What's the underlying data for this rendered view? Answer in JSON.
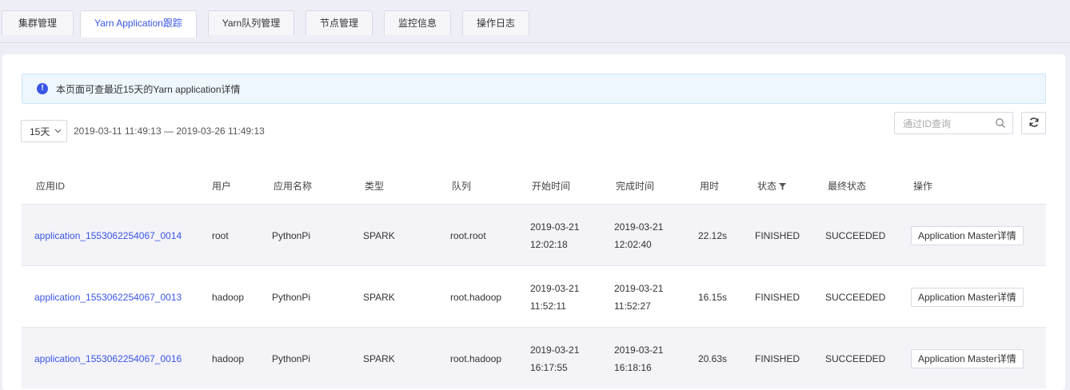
{
  "tabs": [
    {
      "label": "集群管理",
      "active": false
    },
    {
      "label": "Yarn Application跟踪",
      "active": true
    },
    {
      "label": "Yarn队列管理",
      "active": false
    },
    {
      "label": "节点管理",
      "active": false
    },
    {
      "label": "监控信息",
      "active": false
    },
    {
      "label": "操作日志",
      "active": false
    }
  ],
  "notice": {
    "icon": "info-icon",
    "text": "本页面可查最近15天的Yarn application详情"
  },
  "toolbar": {
    "range_value": "15天",
    "range_text": "2019-03-11 11:49:13 — 2019-03-26 11:49:13",
    "search_placeholder": "通过ID查询",
    "refresh_icon": "refresh-icon"
  },
  "table": {
    "headers": {
      "app_id": "应用ID",
      "user": "用户",
      "name": "应用名称",
      "type": "类型",
      "queue": "队列",
      "start": "开始时间",
      "finish": "完成时间",
      "elapsed": "用时",
      "state": "状态",
      "final_state": "最终状态",
      "action": "操作"
    },
    "rows": [
      {
        "app_id": "application_1553062254067_0014",
        "user": "root",
        "name": "PythonPi",
        "type": "SPARK",
        "queue": "root.root",
        "start_date": "2019-03-21",
        "start_time": "12:02:18",
        "finish_date": "2019-03-21",
        "finish_time": "12:02:40",
        "elapsed": "22.12s",
        "state": "FINISHED",
        "final_state": "SUCCEEDED",
        "action": "Application Master详情"
      },
      {
        "app_id": "application_1553062254067_0013",
        "user": "hadoop",
        "name": "PythonPi",
        "type": "SPARK",
        "queue": "root.hadoop",
        "start_date": "2019-03-21",
        "start_time": "11:52:11",
        "finish_date": "2019-03-21",
        "finish_time": "11:52:27",
        "elapsed": "16.15s",
        "state": "FINISHED",
        "final_state": "SUCCEEDED",
        "action": "Application Master详情"
      },
      {
        "app_id": "application_1553062254067_0016",
        "user": "hadoop",
        "name": "PythonPi",
        "type": "SPARK",
        "queue": "root.hadoop",
        "start_date": "2019-03-21",
        "start_time": "16:17:55",
        "finish_date": "2019-03-21",
        "finish_time": "16:18:16",
        "elapsed": "20.63s",
        "state": "FINISHED",
        "final_state": "SUCCEEDED",
        "action": "Application Master详情"
      }
    ]
  },
  "colors": {
    "accent": "#3a55e6",
    "page_bg": "#eeeff6",
    "alt_row": "#f3f3f8",
    "notice_bg": "#eef6fe"
  }
}
